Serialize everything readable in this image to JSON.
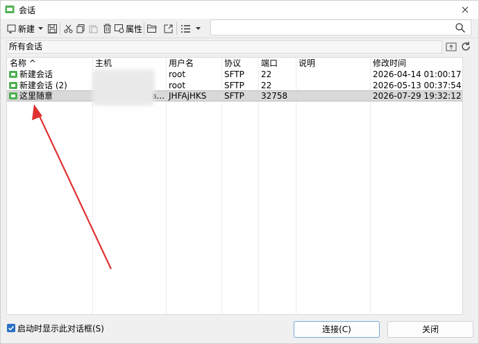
{
  "window": {
    "title": "会话"
  },
  "toolbar": {
    "new_label": "新建",
    "properties_label": "属性",
    "search_value": "",
    "search_placeholder": ""
  },
  "breadcrumb": {
    "path": "所有会话"
  },
  "list": {
    "columns": [
      "名称 ^",
      "主机",
      "用户名",
      "协议",
      "端口",
      "说明",
      "修改时间"
    ],
    "rows": [
      {
        "name": "新建会话",
        "host": "",
        "user": "root",
        "protocol": "SFTP",
        "port": "22",
        "desc": "",
        "modified": "2026-04-14 01:00:17",
        "selected": false
      },
      {
        "name": "新建会话 (2)",
        "host": "",
        "user": "root",
        "protocol": "SFTP",
        "port": "22",
        "desc": "",
        "modified": "2026-05-13 00:37:54",
        "selected": false
      },
      {
        "name": "这里随意",
        "host": "a...",
        "user": "JHFAjHKS",
        "protocol": "SFTP",
        "port": "32758",
        "desc": "",
        "modified": "2026-07-29 19:32:12",
        "selected": true
      }
    ]
  },
  "footer": {
    "show_on_startup_label": "启动时显示此对话框(S)",
    "show_on_startup_checked": true,
    "connect_label": "连接(C)",
    "close_label": "关闭"
  },
  "colors": {
    "accent": "#2b6fc6",
    "session_icon": "#4caf50",
    "annotation_arrow": "#e03030",
    "selected_row": "#d9d9d9"
  }
}
